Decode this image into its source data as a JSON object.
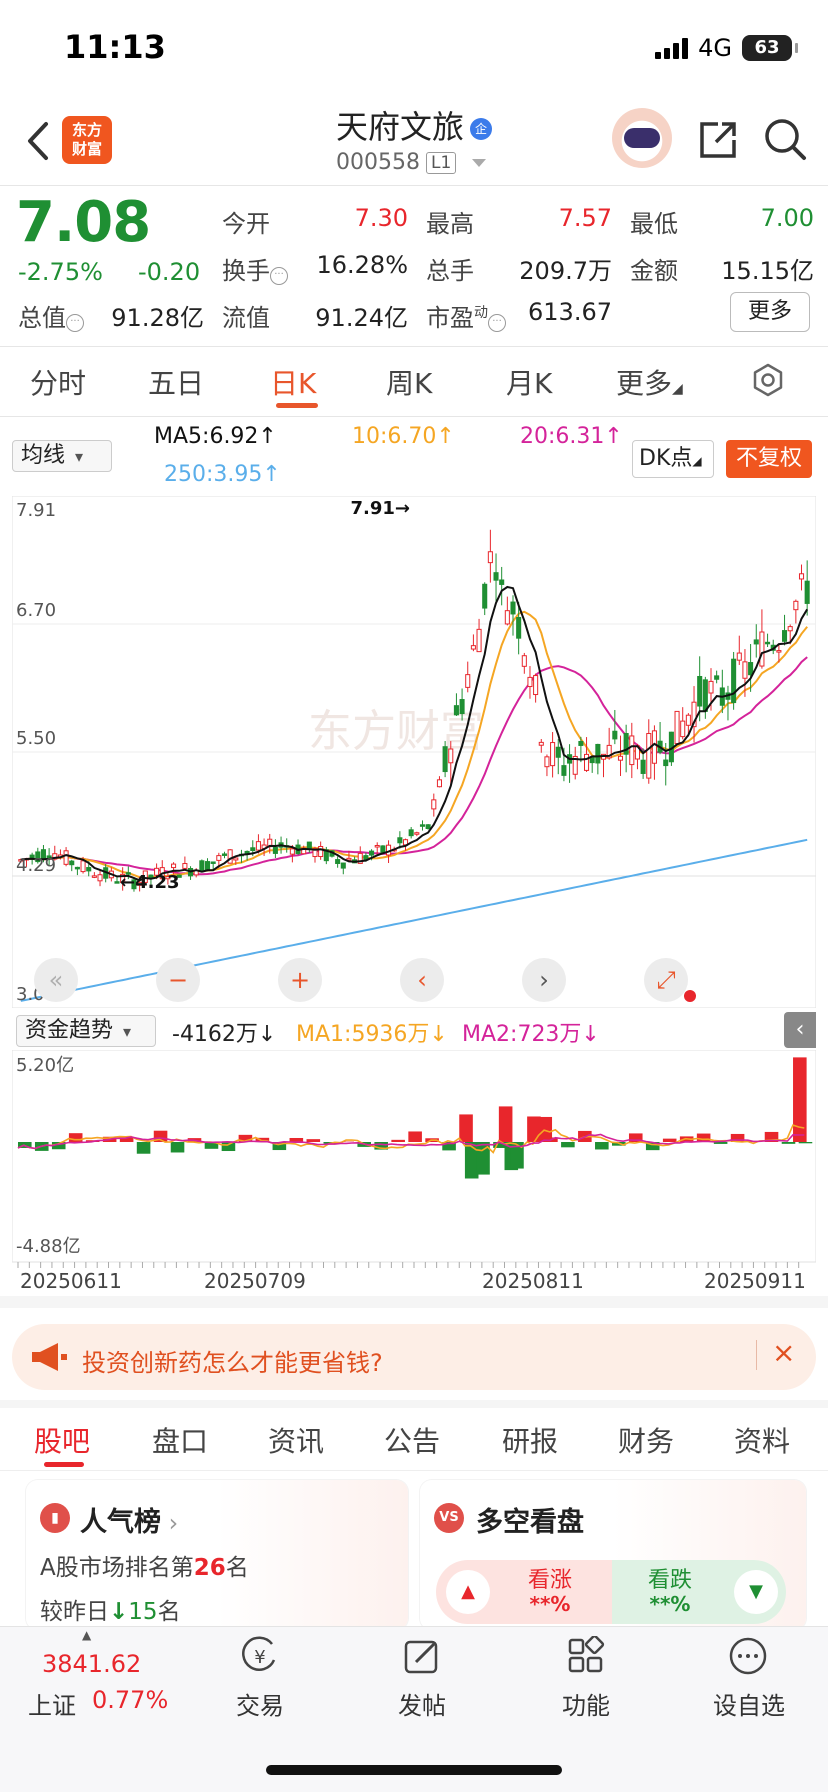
{
  "status_bar": {
    "time": "11:13",
    "network": "4G",
    "battery": "63"
  },
  "header": {
    "logo_text_1": "东方",
    "logo_text_2": "财富",
    "name": "天府文旅",
    "badge": "企",
    "code": "000558",
    "level": "L1"
  },
  "quote": {
    "price": "7.08",
    "change_pct": "-2.75%",
    "change": "-0.20",
    "open_label": "今开",
    "open": "7.30",
    "high_label": "最高",
    "high": "7.57",
    "low_label": "最低",
    "low": "7.00",
    "turnover_label": "换手",
    "turnover": "16.28%",
    "volume_label": "总手",
    "volume": "209.7万",
    "amount_label": "金额",
    "amount": "15.15亿",
    "mktcap_label": "总值",
    "mktcap": "91.28亿",
    "float_label": "流值",
    "float_cap": "91.24亿",
    "pe_label": "市盈",
    "pe_sup": "动",
    "pe": "613.67",
    "more": "更多"
  },
  "period_tabs": [
    "分时",
    "五日",
    "日K",
    "周K",
    "月K",
    "更多"
  ],
  "indicator": {
    "select": "均线",
    "ma5": "MA5:6.92↑",
    "ma10": "10:6.70↑",
    "ma20": "20:6.31↑",
    "ma250": "250:3.95↑",
    "dk": "DK点",
    "fq": "不复权"
  },
  "chart_labels": {
    "y_top": "7.91",
    "y_2": "6.70",
    "y_3": "5.50",
    "y_4": "4.29",
    "y_bottom": "3.08",
    "max_note": "7.91→",
    "min_note": "←4.23",
    "watermark": "东方财富",
    "sub_top": "5.20亿",
    "sub_bottom": "-4.88亿",
    "dates": [
      "20250611",
      "20250709",
      "20250811",
      "20250911"
    ]
  },
  "chart_data": {
    "type": "candlestick",
    "ylim": [
      3.08,
      7.91
    ],
    "y_ticks": [
      7.91,
      6.7,
      5.5,
      4.29,
      3.08
    ],
    "x_ticks": [
      "20250611",
      "20250709",
      "20250811",
      "20250911"
    ],
    "last_close": 7.08,
    "period_high": 7.91,
    "period_low": 4.23,
    "ma_lines": [
      {
        "name": "MA5",
        "value": 6.92
      },
      {
        "name": "10",
        "value": 6.7
      },
      {
        "name": "20",
        "value": 6.31
      },
      {
        "name": "250",
        "value": 3.95
      }
    ],
    "sub_chart": {
      "name": "资金趋势",
      "ylim": [
        -4.88,
        5.2
      ],
      "value": "-4162万",
      "ma1": "MA1:5936万",
      "ma2": "MA2:723万"
    }
  },
  "sub_indicator": {
    "select": "资金趋势",
    "value": "-4162万↓",
    "ma1": "MA1:5936万↓",
    "ma2": "MA2:723万↓"
  },
  "ad": {
    "text": "投资创新药怎么才能更省钱?"
  },
  "bottom_tabs": [
    "股吧",
    "盘口",
    "资讯",
    "公告",
    "研报",
    "财务",
    "资料"
  ],
  "cards": {
    "popularity": {
      "title": "人气榜",
      "line1_a": "A股市场排名第",
      "rank": "26",
      "line1_b": "名",
      "line2_a": "较昨日",
      "delta": "15",
      "line2_b": "名"
    },
    "longshort": {
      "title": "多空看盘",
      "up": "看涨",
      "up_val": "**%",
      "down": "看跌",
      "down_val": "**%"
    }
  },
  "bottom_nav": {
    "index_value": "3841.62",
    "index_name": "上证",
    "index_change": "0.77%",
    "items": [
      "交易",
      "发帖",
      "功能",
      "设自选"
    ]
  },
  "colors": {
    "accent": "#f0561f",
    "up": "#e8262c",
    "down": "#1f8f33",
    "ma5": "#111111",
    "ma10": "#f5a623",
    "ma20": "#d4239a",
    "ma250": "#5aaeea"
  }
}
